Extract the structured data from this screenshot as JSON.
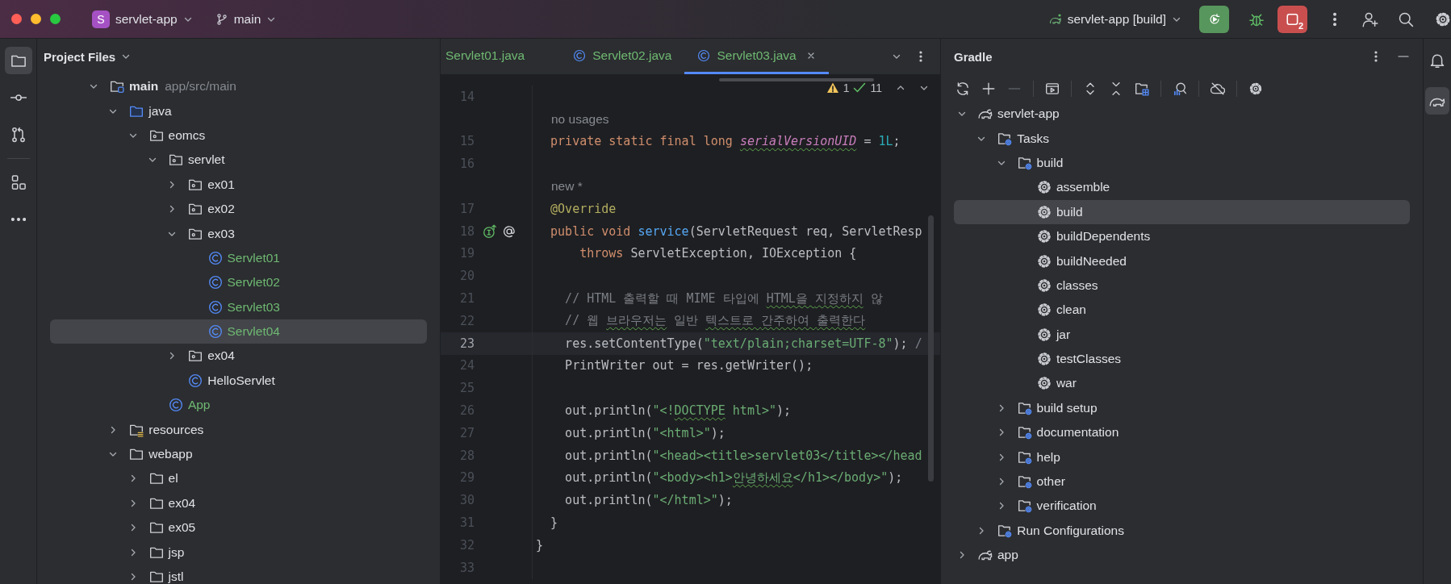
{
  "title_bar": {
    "project_initial": "S",
    "project": "servlet-app",
    "branch": "main",
    "run_config": "servlet-app [build]",
    "stop_badge": "2"
  },
  "left_toolbar": [
    {
      "kind": "project",
      "selected": true
    },
    {
      "kind": "commit",
      "selected": false
    },
    {
      "kind": "pull-requests",
      "selected": false
    },
    {
      "kind": "structure",
      "selected": false
    },
    {
      "kind": "more",
      "selected": false
    }
  ],
  "project_panel": {
    "title": "Project Files",
    "tree": [
      {
        "kind": "module",
        "label": "main",
        "hint": "app/src/main",
        "expanded": true,
        "selected": false,
        "added": false,
        "children": [
          {
            "kind": "source-folder",
            "label": "java",
            "expanded": true,
            "selected": false,
            "added": false,
            "children": [
              {
                "kind": "package",
                "label": "eomcs",
                "expanded": true,
                "selected": false,
                "added": false,
                "children": [
                  {
                    "kind": "package",
                    "label": "servlet",
                    "expanded": true,
                    "selected": false,
                    "added": false,
                    "children": [
                      {
                        "kind": "package",
                        "label": "ex01",
                        "expanded": false,
                        "selected": false,
                        "added": false
                      },
                      {
                        "kind": "package",
                        "label": "ex02",
                        "expanded": false,
                        "selected": false,
                        "added": false
                      },
                      {
                        "kind": "package",
                        "label": "ex03",
                        "expanded": true,
                        "selected": false,
                        "added": false,
                        "children": [
                          {
                            "kind": "class",
                            "label": "Servlet01",
                            "selected": false,
                            "added": true
                          },
                          {
                            "kind": "class",
                            "label": "Servlet02",
                            "selected": false,
                            "added": true
                          },
                          {
                            "kind": "class",
                            "label": "Servlet03",
                            "selected": false,
                            "added": true
                          },
                          {
                            "kind": "class",
                            "label": "Servlet04",
                            "selected": true,
                            "added": true
                          }
                        ]
                      },
                      {
                        "kind": "package",
                        "label": "ex04",
                        "expanded": false,
                        "selected": false,
                        "added": false
                      },
                      {
                        "kind": "class",
                        "label": "HelloServlet",
                        "selected": false,
                        "added": false
                      }
                    ]
                  },
                  {
                    "kind": "class",
                    "label": "App",
                    "selected": false,
                    "added": true
                  }
                ]
              }
            ]
          },
          {
            "kind": "resource-folder",
            "label": "resources",
            "expanded": false,
            "selected": false,
            "added": false
          },
          {
            "kind": "folder",
            "label": "webapp",
            "expanded": true,
            "selected": false,
            "added": false,
            "children": [
              {
                "kind": "folder",
                "label": "el",
                "expanded": false,
                "selected": false,
                "added": false
              },
              {
                "kind": "folder",
                "label": "ex04",
                "expanded": false,
                "selected": false,
                "added": false
              },
              {
                "kind": "folder",
                "label": "ex05",
                "expanded": false,
                "selected": false,
                "added": false
              },
              {
                "kind": "folder",
                "label": "jsp",
                "expanded": false,
                "selected": false,
                "added": false
              },
              {
                "kind": "folder",
                "label": "jstl",
                "expanded": false,
                "selected": false,
                "added": false
              }
            ]
          }
        ]
      }
    ]
  },
  "editor": {
    "tabs": [
      {
        "label": "Servlet01.java",
        "icon": false,
        "selected": false
      },
      {
        "label": "Servlet02.java",
        "icon": true,
        "selected": false
      },
      {
        "label": "Servlet03.java",
        "icon": true,
        "selected": true
      }
    ],
    "warnings": "1",
    "weak_warnings": "11",
    "lines": [
      {
        "kind": "code",
        "number": "14",
        "current": false
      },
      {
        "kind": "hint",
        "text": "no usages"
      },
      {
        "kind": "code",
        "number": "15",
        "current": false,
        "tokens": [
          {
            "kind": "kw",
            "text": "  private static final long "
          },
          {
            "kind": "field",
            "text": "serialVersionUID"
          },
          {
            "kind": "plain",
            "text": " = "
          },
          {
            "kind": "num",
            "text": "1L"
          },
          {
            "kind": "plain",
            "text": ";"
          }
        ]
      },
      {
        "kind": "code",
        "number": "16",
        "current": false
      },
      {
        "kind": "hint",
        "text": "new *"
      },
      {
        "kind": "code",
        "number": "17",
        "current": false,
        "tokens": [
          {
            "kind": "ann",
            "text": "  @Override"
          }
        ]
      },
      {
        "kind": "code",
        "number": "18",
        "current": false,
        "gutter": [
          {
            "kind": "implements"
          },
          {
            "kind": "annotation"
          }
        ],
        "tokens": [
          {
            "kind": "kw",
            "text": "  public void "
          },
          {
            "kind": "fn",
            "text": "service"
          },
          {
            "kind": "plain",
            "text": "(ServletRequest req, ServletResp"
          }
        ]
      },
      {
        "kind": "code",
        "number": "19",
        "current": false,
        "tokens": [
          {
            "kind": "kw",
            "text": "      throws "
          },
          {
            "kind": "plain",
            "text": "ServletException, IOException {"
          }
        ]
      },
      {
        "kind": "code",
        "number": "20",
        "current": false
      },
      {
        "kind": "code",
        "number": "21",
        "current": false,
        "tokens": [
          {
            "kind": "cmt",
            "text": "    // HTML 출력할 때 MIME 타입에 "
          },
          {
            "kind": "cmt-typo",
            "text": "HTML을 "
          },
          {
            "kind": "cmt-typo",
            "text": "지정하지"
          },
          {
            "kind": "cmt",
            "text": " 않"
          }
        ]
      },
      {
        "kind": "code",
        "number": "22",
        "current": false,
        "tokens": [
          {
            "kind": "cmt",
            "text": "    // 웹 "
          },
          {
            "kind": "cmt-typo",
            "text": "브라우저는"
          },
          {
            "kind": "cmt",
            "text": " 일반 "
          },
          {
            "kind": "cmt-typo",
            "text": "텍스트로 "
          },
          {
            "kind": "cmt-typo",
            "text": "간주하여 "
          },
          {
            "kind": "cmt-typo",
            "text": "출력한다"
          }
        ]
      },
      {
        "kind": "code",
        "number": "23",
        "current": true,
        "tokens": [
          {
            "kind": "plain",
            "text": "    res.setContentType("
          },
          {
            "kind": "str",
            "text": "\"text/plain;charset=UTF-8\""
          },
          {
            "kind": "plain",
            "text": "); "
          },
          {
            "kind": "cmt",
            "text": "/"
          }
        ]
      },
      {
        "kind": "code",
        "number": "24",
        "current": false,
        "tokens": [
          {
            "kind": "plain",
            "text": "    PrintWriter out = res.getWriter();"
          }
        ]
      },
      {
        "kind": "code",
        "number": "25",
        "current": false
      },
      {
        "kind": "code",
        "number": "26",
        "current": false,
        "tokens": [
          {
            "kind": "plain",
            "text": "    out.println("
          },
          {
            "kind": "str",
            "text": "\"<!"
          },
          {
            "kind": "str-typo",
            "text": "DOCTYPE"
          },
          {
            "kind": "str",
            "text": " html>\""
          },
          {
            "kind": "plain",
            "text": ");"
          }
        ]
      },
      {
        "kind": "code",
        "number": "27",
        "current": false,
        "tokens": [
          {
            "kind": "plain",
            "text": "    out.println("
          },
          {
            "kind": "str",
            "text": "\"<html>\""
          },
          {
            "kind": "plain",
            "text": ");"
          }
        ]
      },
      {
        "kind": "code",
        "number": "28",
        "current": false,
        "tokens": [
          {
            "kind": "plain",
            "text": "    out.println("
          },
          {
            "kind": "str",
            "text": "\"<head><title>servlet03</title></head"
          }
        ]
      },
      {
        "kind": "code",
        "number": "29",
        "current": false,
        "tokens": [
          {
            "kind": "plain",
            "text": "    out.println("
          },
          {
            "kind": "str",
            "text": "\"<body><h1>"
          },
          {
            "kind": "str-typo",
            "text": "안녕하세요"
          },
          {
            "kind": "str",
            "text": "</h1></body>\""
          },
          {
            "kind": "plain",
            "text": ");"
          }
        ]
      },
      {
        "kind": "code",
        "number": "30",
        "current": false,
        "tokens": [
          {
            "kind": "plain",
            "text": "    out.println("
          },
          {
            "kind": "str",
            "text": "\"</html>\""
          },
          {
            "kind": "plain",
            "text": ");"
          }
        ]
      },
      {
        "kind": "code",
        "number": "31",
        "current": false,
        "tokens": [
          {
            "kind": "plain",
            "text": "  }"
          }
        ]
      },
      {
        "kind": "code",
        "number": "32",
        "current": false,
        "tokens": [
          {
            "kind": "plain",
            "text": "}"
          }
        ]
      },
      {
        "kind": "code",
        "number": "33",
        "current": false
      }
    ]
  },
  "gradle_panel": {
    "title": "Gradle",
    "toolbar": [
      {
        "kind": "refresh",
        "disabled": false
      },
      {
        "kind": "add",
        "disabled": false
      },
      {
        "kind": "remove",
        "disabled": true
      },
      {
        "kind": "run-task",
        "disabled": false
      },
      {
        "kind": "expand-all",
        "disabled": false
      },
      {
        "kind": "collapse-all",
        "disabled": false
      },
      {
        "kind": "dependencies",
        "disabled": false
      },
      {
        "kind": "analyze",
        "disabled": false
      },
      {
        "kind": "offline",
        "disabled": false
      },
      {
        "kind": "settings",
        "disabled": false
      }
    ],
    "tree": [
      {
        "kind": "project",
        "label": "servlet-app",
        "expanded": true,
        "selected": false,
        "children": [
          {
            "kind": "group",
            "label": "Tasks",
            "expanded": true,
            "selected": false,
            "children": [
              {
                "kind": "group",
                "label": "build",
                "expanded": true,
                "selected": false,
                "children": [
                  {
                    "kind": "task",
                    "label": "assemble",
                    "selected": false
                  },
                  {
                    "kind": "task",
                    "label": "build",
                    "selected": true
                  },
                  {
                    "kind": "task",
                    "label": "buildDependents",
                    "selected": false
                  },
                  {
                    "kind": "task",
                    "label": "buildNeeded",
                    "selected": false
                  },
                  {
                    "kind": "task",
                    "label": "classes",
                    "selected": false
                  },
                  {
                    "kind": "task",
                    "label": "clean",
                    "selected": false
                  },
                  {
                    "kind": "task",
                    "label": "jar",
                    "selected": false
                  },
                  {
                    "kind": "task",
                    "label": "testClasses",
                    "selected": false
                  },
                  {
                    "kind": "task",
                    "label": "war",
                    "selected": false
                  }
                ]
              },
              {
                "kind": "group",
                "label": "build setup",
                "expanded": false,
                "selected": false
              },
              {
                "kind": "group",
                "label": "documentation",
                "expanded": false,
                "selected": false
              },
              {
                "kind": "group",
                "label": "help",
                "expanded": false,
                "selected": false
              },
              {
                "kind": "group",
                "label": "other",
                "expanded": false,
                "selected": false
              },
              {
                "kind": "group",
                "label": "verification",
                "expanded": false,
                "selected": false
              }
            ]
          },
          {
            "kind": "group",
            "label": "Run Configurations",
            "expanded": false,
            "selected": false
          }
        ]
      },
      {
        "kind": "project",
        "label": "app",
        "expanded": false,
        "selected": false
      }
    ]
  },
  "right_toolbar": [
    {
      "kind": "notifications",
      "selected": false
    },
    {
      "kind": "gradle",
      "selected": true
    }
  ]
}
